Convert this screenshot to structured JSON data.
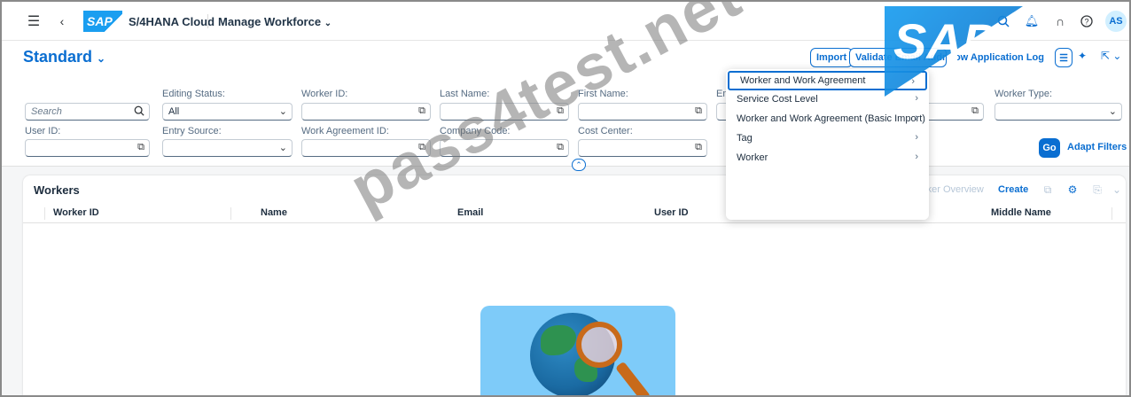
{
  "shell": {
    "brand": "S/4HANA Cloud",
    "app_title": "Manage Workforce",
    "logo_text": "SAP",
    "avatar_initials": "AS"
  },
  "big_logo_text": "SAP",
  "header": {
    "variant_title": "Standard",
    "actions": {
      "import": "Import",
      "validate": "Validate Email Addresses",
      "show_log": "Show Application Log"
    }
  },
  "filters": {
    "search_placeholder": "Search",
    "editing_status_label": "Editing Status:",
    "editing_status_value": "All",
    "worker_id_label": "Worker ID:",
    "last_name_label": "Last Name:",
    "first_name_label": "First Name:",
    "em_label_partial": "Em",
    "worker_type_label": "Worker Type:",
    "user_id_label": "User ID:",
    "entry_source_label": "Entry Source:",
    "work_agreement_id_label": "Work Agreement ID:",
    "company_code_label": "Company Code:",
    "cost_center_label": "Cost Center:",
    "go_label": "Go",
    "adapt_filters_label": "Adapt Filters"
  },
  "table": {
    "title": "Workers",
    "toolbar": {
      "worker_overview": "rker Overview",
      "create": "Create"
    },
    "columns": [
      "Worker ID",
      "Name",
      "Email",
      "User ID",
      "Middle Name"
    ]
  },
  "menu": {
    "items": [
      {
        "label": "Worker and Work Agreement"
      },
      {
        "label": "Service Cost Level"
      },
      {
        "label": "Worker and Work Agreement (Basic Import)"
      },
      {
        "label": "Tag"
      },
      {
        "label": "Worker"
      }
    ]
  },
  "watermark": "pass4test.net",
  "colors": {
    "accent": "#0a6ed1",
    "shell_bg": "#ffffff",
    "page_bg": "#f5f6f7"
  }
}
